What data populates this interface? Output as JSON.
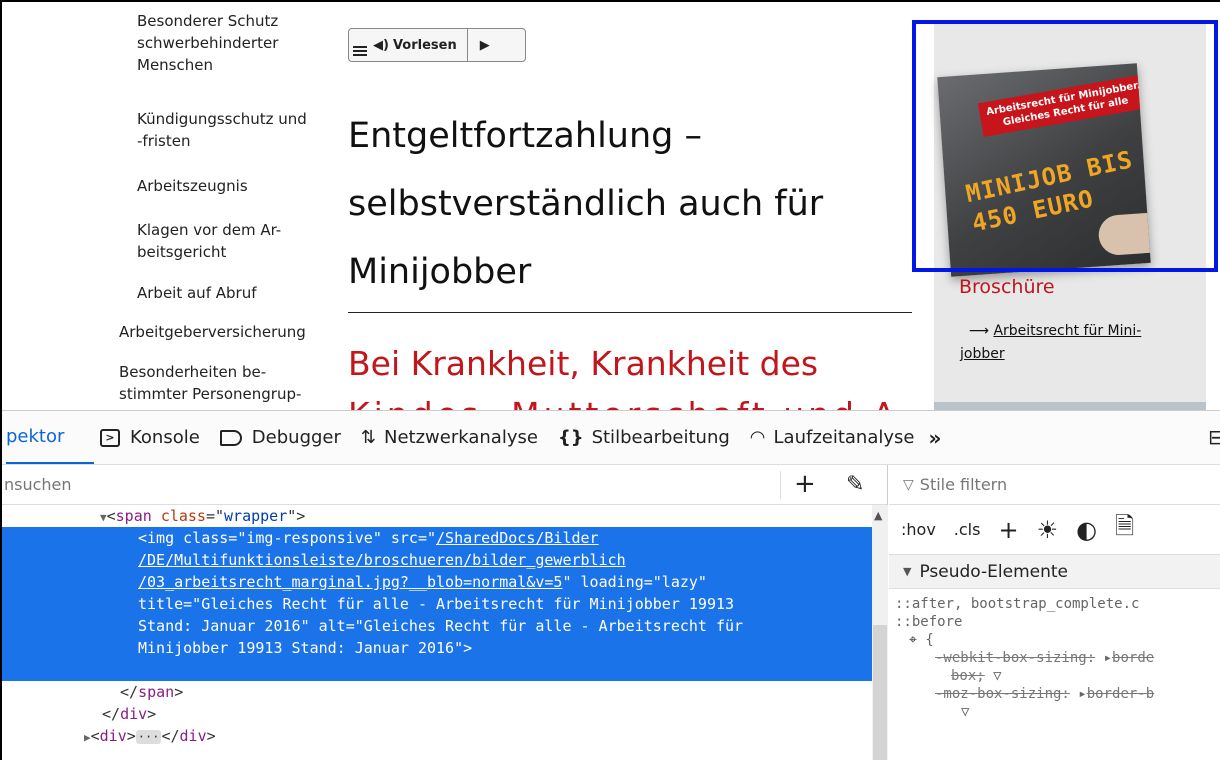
{
  "page": {
    "sidenav": [
      {
        "level": 2,
        "lines": [
          "Besonderer Schutz",
          "schwerbehinderter",
          "Menschen"
        ]
      },
      {
        "level": 2,
        "lines": [
          "Kündigungsschutz und",
          "-fristen"
        ]
      },
      {
        "level": 2,
        "lines": [
          "Arbeitszeugnis"
        ]
      },
      {
        "level": 2,
        "lines": [
          "Klagen vor dem Ar-",
          "beitsgericht"
        ]
      },
      {
        "level": 2,
        "lines": [
          "Arbeit auf Abruf"
        ]
      },
      {
        "level": 1,
        "lines": [
          "Arbeitgeberversicherung"
        ]
      },
      {
        "level": 1,
        "lines": [
          "Besonderheiten be-",
          "stimmter Personengrup-"
        ]
      }
    ],
    "vorlesen_label": "Vorlesen",
    "headline": [
      "Entgeltfortzahlung –",
      "selbstverständlich auch für",
      "Minijobber"
    ],
    "subhead": "Bei Krankheit, Krankheit des",
    "subhead_cut": "Kindes, Mutterschaft und A",
    "brochure_image": {
      "banner": [
        "Arbeitsrecht für Minijobber.",
        "Gleiches Recht für alle"
      ],
      "chalk": [
        "MINIJOB BIS",
        "450 EURO"
      ]
    },
    "brochure_title": "Broschüre",
    "brochure_arrow": "⟶",
    "brochure_link": [
      "Arbeitsrecht für Mini-",
      "jobber"
    ],
    "highlight_color": "#0017e6",
    "accent_red": "#c0161c"
  },
  "devtools": {
    "tabs": [
      {
        "label": "pektor",
        "icon": "inspector-icon",
        "active": true
      },
      {
        "label": "Konsole",
        "icon": "console-icon"
      },
      {
        "label": "Debugger",
        "icon": "debugger-icon"
      },
      {
        "label": "Netzwerkanalyse",
        "icon": "network-icon"
      },
      {
        "label": "Stilbearbeitung",
        "icon": "braces-icon"
      },
      {
        "label": "Laufzeitanalyse",
        "icon": "performance-icon"
      }
    ],
    "search_placeholder": "nsuchen",
    "tree": {
      "span_open": {
        "tag": "span",
        "attr": "class",
        "value": "wrapper"
      },
      "img": {
        "tag": "img",
        "class_value": "img-responsive",
        "src_lines": [
          "/SharedDocs/Bilder",
          "/DE/Multifunktionsleiste/broschueren/bilder_gewerblich",
          "/03_arbeitsrecht_marginal.jpg?__blob=normal&v=5"
        ],
        "loading_value": "lazy",
        "title_lines": [
          "Gleiches Recht für alle - Arbeitsrecht für Minijobber 19913",
          "Stand: Januar 2016"
        ],
        "alt_lines": [
          "Gleiches Recht für alle - Arbeitsrecht für",
          "Minijobber 19913 Stand: Januar 2016"
        ]
      },
      "span_close": "</span>",
      "div_close": "</div>",
      "div_collapsed": "div"
    },
    "styles": {
      "filter_placeholder": "Stile filtern",
      "hov": ":hov",
      "cls": ".cls",
      "section": "Pseudo-Elemente",
      "selector_lines": [
        "::after,  bootstrap_complete.c",
        "::before"
      ],
      "rules": [
        {
          "prop": "-webkit-box-sizing:",
          "value": "borde",
          "cont": "box;"
        },
        {
          "prop": "-moz-box-sizing:",
          "value": "border-b"
        }
      ]
    }
  }
}
